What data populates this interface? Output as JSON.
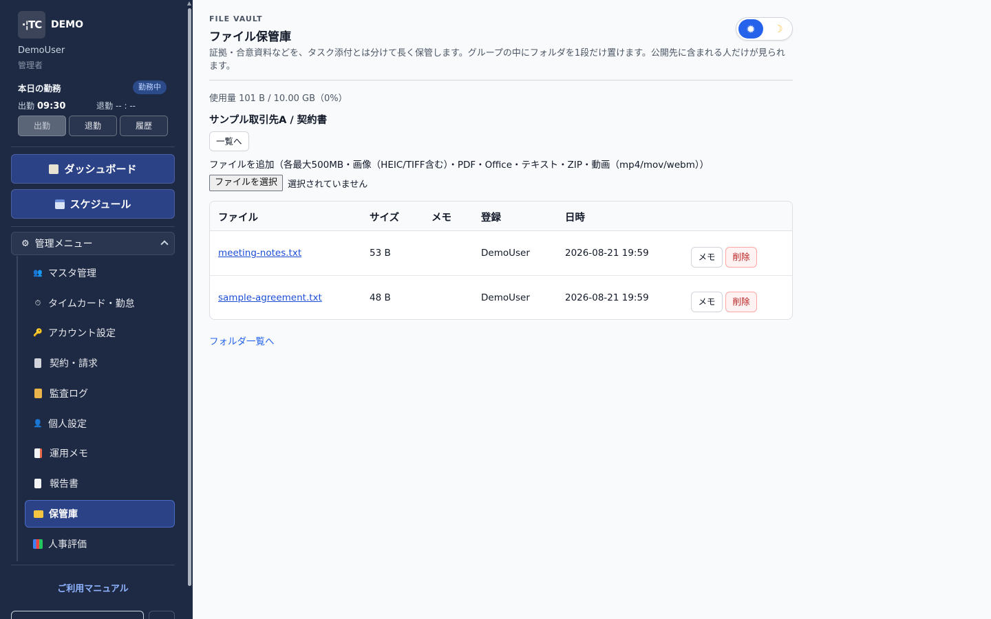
{
  "sidebar": {
    "brand_logo": "·¦TC",
    "brand_name": "DEMO",
    "user_name": "DemoUser",
    "user_role": "管理者",
    "attendance": {
      "title": "本日の勤務",
      "status_badge": "勤務中",
      "clock_in_label": "出勤",
      "clock_in_time": "09:30",
      "clock_out_label": "退勤",
      "clock_out_time": "-- : --",
      "btn_clock_in": "出勤",
      "btn_clock_out": "退勤",
      "btn_history": "履歴"
    },
    "dashboard_label": "ダッシュボード",
    "schedule_label": "スケジュール",
    "admin_menu_label": "管理メニュー",
    "items": [
      {
        "label": "マスタ管理",
        "icon": "users-icon"
      },
      {
        "label": "タイムカード・勤怠",
        "icon": "stopwatch-icon"
      },
      {
        "label": "アカウント設定",
        "icon": "key-icon"
      },
      {
        "label": "契約・請求",
        "icon": "receipt-icon"
      },
      {
        "label": "監査ログ",
        "icon": "scroll-icon"
      },
      {
        "label": "個人設定",
        "icon": "person-icon"
      },
      {
        "label": "運用メモ",
        "icon": "memo-icon"
      },
      {
        "label": "報告書",
        "icon": "document-icon"
      },
      {
        "label": "保管庫",
        "icon": "folder-icon",
        "active": true
      },
      {
        "label": "人事評価",
        "icon": "bar-chart-icon"
      }
    ],
    "manual_link": "ご利用マニュアル"
  },
  "main": {
    "eyebrow": "FILE VAULT",
    "title": "ファイル保管庫",
    "description": "証拠・合意資料などを、タスク添付とは分けて長く保管します。グループの中にフォルダを1段だけ置けます。公開先に含まれる人だけが見られます。",
    "usage": "使用量 101 B / 10.00 GB（0%）",
    "folder_title": "サンプル取引先A / 契約書",
    "back_button": "一覧へ",
    "add_label": "ファイルを追加（各最大500MB・画像（HEIC/TIFF含む）・PDF・Office・テキスト・ZIP・動画（mp4/mov/webm））",
    "file_button": "ファイルを選択",
    "file_none": "選択されていません",
    "table": {
      "headers": [
        "ファイル",
        "サイズ",
        "メモ",
        "登録",
        "日時"
      ],
      "rows": [
        {
          "file": "meeting-notes.txt",
          "size": "53 B",
          "memo": "",
          "user": "DemoUser",
          "datetime": "2026-08-21 19:59",
          "memo_btn": "メモ",
          "delete_btn": "削除"
        },
        {
          "file": "sample-agreement.txt",
          "size": "48 B",
          "memo": "",
          "user": "DemoUser",
          "datetime": "2026-08-21 19:59",
          "memo_btn": "メモ",
          "delete_btn": "削除"
        }
      ]
    },
    "folder_list_link": "フォルダ一覧へ"
  },
  "theme": {
    "light_icon": "sun-icon",
    "dark_icon": "moon-icon",
    "active": "light",
    "accent": "#2563eb"
  },
  "colors": {
    "sidebar_bg": "#1e2a44",
    "primary_button": "#2c4287",
    "link": "#2563eb",
    "danger": "#b91c1c"
  }
}
